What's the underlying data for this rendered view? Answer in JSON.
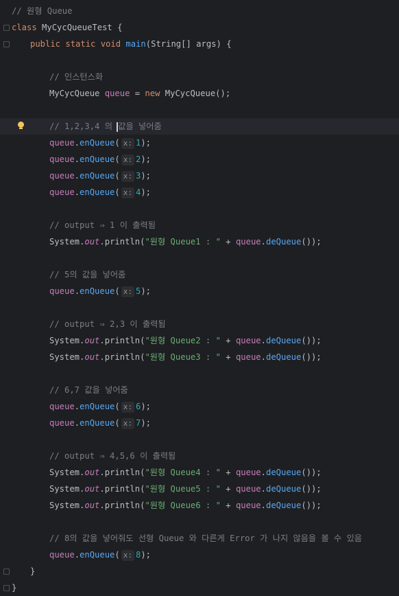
{
  "editor": {
    "lines": [
      {
        "id": "l1",
        "parts": [
          {
            "c": "cm",
            "t": "// 원형 Queue"
          }
        ]
      },
      {
        "id": "l2",
        "parts": [
          {
            "c": "kw",
            "t": "class "
          },
          {
            "c": "cls",
            "t": "MyCycQueueTest "
          },
          {
            "c": "plain",
            "t": "{"
          }
        ]
      },
      {
        "id": "l3",
        "parts": [
          {
            "c": "kw",
            "t": "public static void "
          },
          {
            "c": "fn",
            "t": "main"
          },
          {
            "c": "plain",
            "t": "("
          },
          {
            "c": "cls",
            "t": "String"
          },
          {
            "c": "plain",
            "t": "[] "
          },
          {
            "c": "plain",
            "t": "args"
          },
          {
            "c": "plain",
            "t": ") {"
          }
        ]
      },
      {
        "id": "l4",
        "parts": []
      },
      {
        "id": "l5",
        "parts": [
          {
            "c": "cm",
            "t": "// 인스턴스화"
          }
        ]
      },
      {
        "id": "l6",
        "parts": [
          {
            "c": "cls",
            "t": "MyCycQueue "
          },
          {
            "c": "var",
            "t": "queue"
          },
          {
            "c": "plain",
            "t": " = "
          },
          {
            "c": "kw",
            "t": "new "
          },
          {
            "c": "cls",
            "t": "MyCycQueue"
          },
          {
            "c": "plain",
            "t": "();"
          }
        ]
      },
      {
        "id": "l7",
        "parts": []
      },
      {
        "id": "l8",
        "parts": [
          {
            "c": "cm",
            "t": "// 1,2,3,4 의 값을 넣어줌"
          }
        ]
      },
      {
        "id": "l9",
        "parts": [
          {
            "c": "var",
            "t": "queue"
          },
          {
            "c": "plain",
            "t": "."
          },
          {
            "c": "fn",
            "t": "enQueue"
          },
          {
            "c": "plain",
            "t": "("
          },
          {
            "c": "hint",
            "t": "x:"
          },
          {
            "c": "num",
            "t": "1"
          },
          {
            "c": "plain",
            "t": ");"
          }
        ]
      },
      {
        "id": "l10",
        "parts": [
          {
            "c": "var",
            "t": "queue"
          },
          {
            "c": "plain",
            "t": "."
          },
          {
            "c": "fn",
            "t": "enQueue"
          },
          {
            "c": "plain",
            "t": "("
          },
          {
            "c": "hint",
            "t": "x:"
          },
          {
            "c": "num",
            "t": "2"
          },
          {
            "c": "plain",
            "t": ");"
          }
        ]
      },
      {
        "id": "l11",
        "parts": [
          {
            "c": "var",
            "t": "queue"
          },
          {
            "c": "plain",
            "t": "."
          },
          {
            "c": "fn",
            "t": "enQueue"
          },
          {
            "c": "plain",
            "t": "("
          },
          {
            "c": "hint",
            "t": "x:"
          },
          {
            "c": "num",
            "t": "3"
          },
          {
            "c": "plain",
            "t": ");"
          }
        ]
      },
      {
        "id": "l12",
        "parts": [
          {
            "c": "var",
            "t": "queue"
          },
          {
            "c": "plain",
            "t": "."
          },
          {
            "c": "fn",
            "t": "enQueue"
          },
          {
            "c": "plain",
            "t": "("
          },
          {
            "c": "hint",
            "t": "x:"
          },
          {
            "c": "num",
            "t": "4"
          },
          {
            "c": "plain",
            "t": ");"
          }
        ]
      },
      {
        "id": "l13",
        "parts": []
      },
      {
        "id": "l14",
        "parts": [
          {
            "c": "cm",
            "t": "// output ⇒ 1 이 출력됨"
          }
        ]
      },
      {
        "id": "l15",
        "parts": [
          {
            "c": "cls",
            "t": "System"
          },
          {
            "c": "plain",
            "t": "."
          },
          {
            "c": "fld italic",
            "t": "out"
          },
          {
            "c": "plain",
            "t": "."
          },
          {
            "c": "plain",
            "t": "println"
          },
          {
            "c": "plain",
            "t": "("
          },
          {
            "c": "str",
            "t": "\"원형 Queue1 : \""
          },
          {
            "c": "plain",
            "t": " + "
          },
          {
            "c": "var",
            "t": "queue"
          },
          {
            "c": "plain",
            "t": "."
          },
          {
            "c": "fn",
            "t": "deQueue"
          },
          {
            "c": "plain",
            "t": "());"
          }
        ]
      },
      {
        "id": "l16",
        "parts": []
      },
      {
        "id": "l17",
        "parts": [
          {
            "c": "cm",
            "t": "// 5의 값을 넣어줌"
          }
        ]
      },
      {
        "id": "l18",
        "parts": [
          {
            "c": "var",
            "t": "queue"
          },
          {
            "c": "plain",
            "t": "."
          },
          {
            "c": "fn",
            "t": "enQueue"
          },
          {
            "c": "plain",
            "t": "("
          },
          {
            "c": "hint",
            "t": "x:"
          },
          {
            "c": "num",
            "t": "5"
          },
          {
            "c": "plain",
            "t": ");"
          }
        ]
      },
      {
        "id": "l19",
        "parts": []
      },
      {
        "id": "l20",
        "parts": [
          {
            "c": "cm",
            "t": "// output ⇒ 2,3 이 출력됨"
          }
        ]
      },
      {
        "id": "l21",
        "parts": [
          {
            "c": "cls",
            "t": "System"
          },
          {
            "c": "plain",
            "t": "."
          },
          {
            "c": "fld italic",
            "t": "out"
          },
          {
            "c": "plain",
            "t": "."
          },
          {
            "c": "plain",
            "t": "println"
          },
          {
            "c": "plain",
            "t": "("
          },
          {
            "c": "str",
            "t": "\"원형 Queue2 : \""
          },
          {
            "c": "plain",
            "t": " + "
          },
          {
            "c": "var",
            "t": "queue"
          },
          {
            "c": "plain",
            "t": "."
          },
          {
            "c": "fn",
            "t": "deQueue"
          },
          {
            "c": "plain",
            "t": "());"
          }
        ]
      },
      {
        "id": "l22",
        "parts": [
          {
            "c": "cls",
            "t": "System"
          },
          {
            "c": "plain",
            "t": "."
          },
          {
            "c": "fld italic",
            "t": "out"
          },
          {
            "c": "plain",
            "t": "."
          },
          {
            "c": "plain",
            "t": "println"
          },
          {
            "c": "plain",
            "t": "("
          },
          {
            "c": "str",
            "t": "\"원형 Queue3 : \""
          },
          {
            "c": "plain",
            "t": " + "
          },
          {
            "c": "var",
            "t": "queue"
          },
          {
            "c": "plain",
            "t": "."
          },
          {
            "c": "fn",
            "t": "deQueue"
          },
          {
            "c": "plain",
            "t": "());"
          }
        ]
      },
      {
        "id": "l23",
        "parts": []
      },
      {
        "id": "l24",
        "parts": [
          {
            "c": "cm",
            "t": "// 6,7 값을 넣어줌"
          }
        ]
      },
      {
        "id": "l25",
        "parts": [
          {
            "c": "var",
            "t": "queue"
          },
          {
            "c": "plain",
            "t": "."
          },
          {
            "c": "fn",
            "t": "enQueue"
          },
          {
            "c": "plain",
            "t": "("
          },
          {
            "c": "hint",
            "t": "x:"
          },
          {
            "c": "num",
            "t": "6"
          },
          {
            "c": "plain",
            "t": ");"
          }
        ]
      },
      {
        "id": "l26",
        "parts": [
          {
            "c": "var",
            "t": "queue"
          },
          {
            "c": "plain",
            "t": "."
          },
          {
            "c": "fn",
            "t": "enQueue"
          },
          {
            "c": "plain",
            "t": "("
          },
          {
            "c": "hint",
            "t": "x:"
          },
          {
            "c": "num",
            "t": "7"
          },
          {
            "c": "plain",
            "t": ");"
          }
        ]
      },
      {
        "id": "l27",
        "parts": []
      },
      {
        "id": "l28",
        "parts": [
          {
            "c": "cm",
            "t": "// output ⇒ 4,5,6 이 출력됨"
          }
        ]
      },
      {
        "id": "l29",
        "parts": [
          {
            "c": "cls",
            "t": "System"
          },
          {
            "c": "plain",
            "t": "."
          },
          {
            "c": "fld italic",
            "t": "out"
          },
          {
            "c": "plain",
            "t": "."
          },
          {
            "c": "plain",
            "t": "println"
          },
          {
            "c": "plain",
            "t": "("
          },
          {
            "c": "str",
            "t": "\"원형 Queue4 : \""
          },
          {
            "c": "plain",
            "t": " + "
          },
          {
            "c": "var",
            "t": "queue"
          },
          {
            "c": "plain",
            "t": "."
          },
          {
            "c": "fn",
            "t": "deQueue"
          },
          {
            "c": "plain",
            "t": "());"
          }
        ]
      },
      {
        "id": "l30",
        "parts": [
          {
            "c": "cls",
            "t": "System"
          },
          {
            "c": "plain",
            "t": "."
          },
          {
            "c": "fld italic",
            "t": "out"
          },
          {
            "c": "plain",
            "t": "."
          },
          {
            "c": "plain",
            "t": "println"
          },
          {
            "c": "plain",
            "t": "("
          },
          {
            "c": "str",
            "t": "\"원형 Queue5 : \""
          },
          {
            "c": "plain",
            "t": " + "
          },
          {
            "c": "var",
            "t": "queue"
          },
          {
            "c": "plain",
            "t": "."
          },
          {
            "c": "fn",
            "t": "deQueue"
          },
          {
            "c": "plain",
            "t": "());"
          }
        ]
      },
      {
        "id": "l31",
        "parts": [
          {
            "c": "cls",
            "t": "System"
          },
          {
            "c": "plain",
            "t": "."
          },
          {
            "c": "fld italic",
            "t": "out"
          },
          {
            "c": "plain",
            "t": "."
          },
          {
            "c": "plain",
            "t": "println"
          },
          {
            "c": "plain",
            "t": "("
          },
          {
            "c": "str",
            "t": "\"원형 Queue6 : \""
          },
          {
            "c": "plain",
            "t": " + "
          },
          {
            "c": "var",
            "t": "queue"
          },
          {
            "c": "plain",
            "t": "."
          },
          {
            "c": "fn",
            "t": "deQueue"
          },
          {
            "c": "plain",
            "t": "());"
          }
        ]
      },
      {
        "id": "l32",
        "parts": []
      },
      {
        "id": "l33",
        "parts": [
          {
            "c": "cm",
            "t": "// 8의 값을 넣어줘도 선형 Queue 와 다른게 Error 가 나지 않음을 볼 수 있음"
          }
        ]
      },
      {
        "id": "l34",
        "parts": [
          {
            "c": "var",
            "t": "queue"
          },
          {
            "c": "plain",
            "t": "."
          },
          {
            "c": "fn",
            "t": "enQueue"
          },
          {
            "c": "plain",
            "t": "("
          },
          {
            "c": "hint",
            "t": "x:"
          },
          {
            "c": "num",
            "t": "8"
          },
          {
            "c": "plain",
            "t": ");"
          }
        ]
      },
      {
        "id": "l35",
        "parts": [
          {
            "c": "plain",
            "t": "}"
          }
        ]
      },
      {
        "id": "l36",
        "parts": [
          {
            "c": "plain",
            "t": "}"
          }
        ]
      }
    ]
  },
  "colors": {
    "background": "#1e1f22",
    "current_line": "#26282e",
    "keyword": "#cf8e6d",
    "comment": "#7a7e85",
    "string": "#6aab73",
    "number": "#2aacb8",
    "function": "#56a8f5",
    "variable": "#c77dbb"
  },
  "icons": {
    "intention_bulb": "lightbulb-icon",
    "fold_marker": "fold-marker-icon"
  }
}
